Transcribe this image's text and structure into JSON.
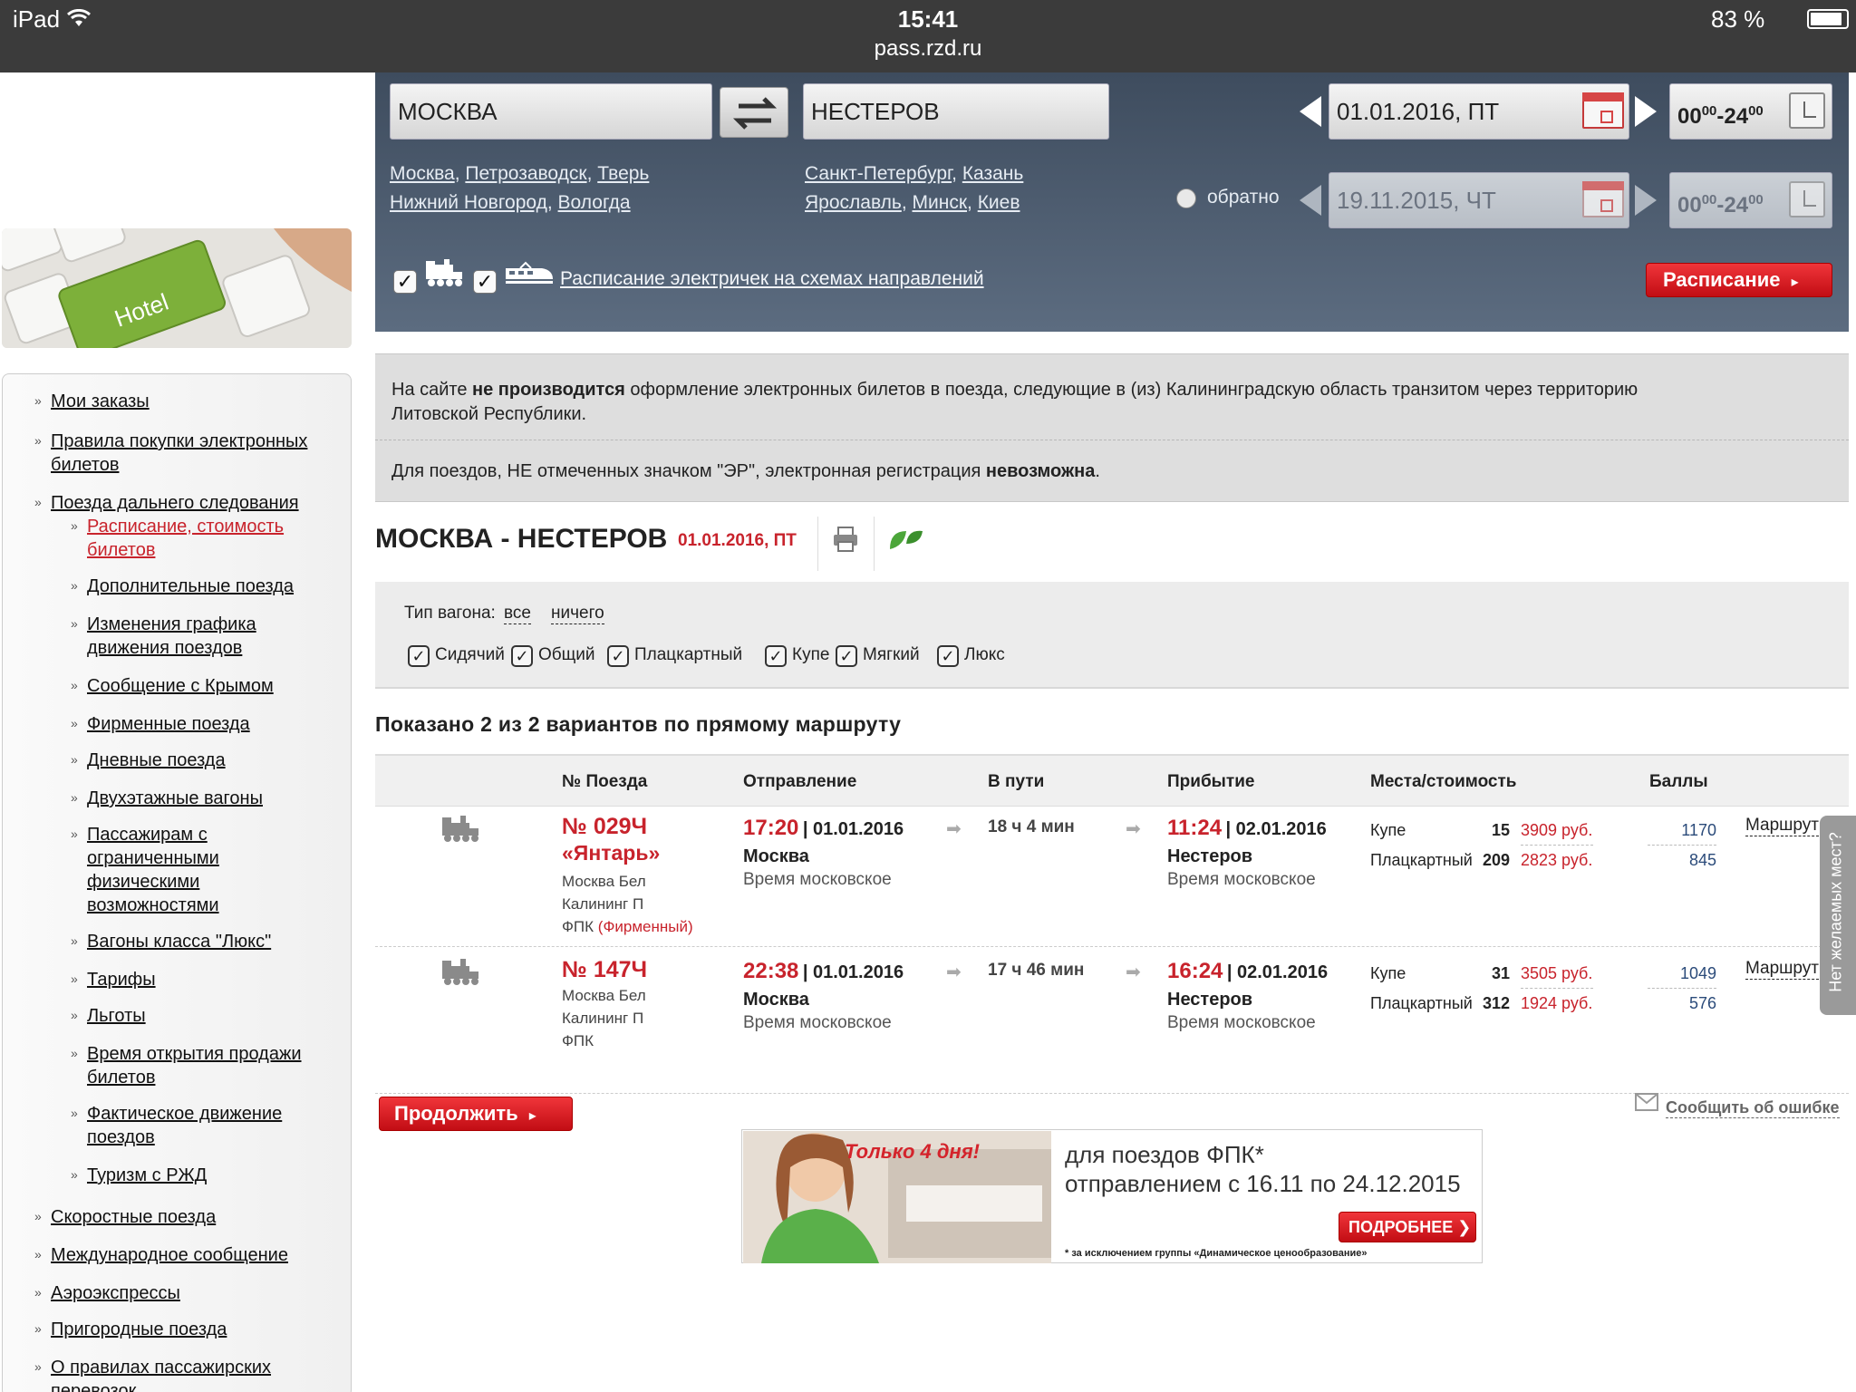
{
  "status_bar": {
    "device": "iPad",
    "time": "15:41",
    "url": "pass.rzd.ru",
    "battery": "83 %"
  },
  "search": {
    "from_value": "МОСКВА",
    "to_value": "НЕСТЕРОВ",
    "from_suggestions": [
      [
        "Москва",
        "Петрозаводск",
        "Тверь"
      ],
      [
        "Нижний Новгород",
        "Вологда"
      ]
    ],
    "to_suggestions": [
      [
        "Санкт-Петербург",
        "Казань"
      ],
      [
        "Ярославль",
        "Минск",
        "Киев"
      ]
    ],
    "date_there": "01.01.2016, ПТ",
    "date_back": "19.11.2015, ЧТ",
    "time_range_there": {
      "from": "00",
      "from_sup": "00",
      "to": "24",
      "to_sup": "00"
    },
    "time_range_back": {
      "from": "00",
      "from_sup": "00",
      "to": "24",
      "to_sup": "00"
    },
    "return_label": "обратно",
    "schedule_link": "Расписание электричек на схемах направлений",
    "schedule_button": "Расписание"
  },
  "sidebar": {
    "items": [
      {
        "label": "Мои заказы",
        "level": 0
      },
      {
        "label": "Правила покупки электронных билетов",
        "level": 0
      },
      {
        "label": "Поезда дальнего следования",
        "level": 0
      },
      {
        "label": "Расписание, стоимость билетов",
        "level": 1,
        "active": true
      },
      {
        "label": "Дополнительные поезда",
        "level": 1
      },
      {
        "label": "Изменения графика движения поездов",
        "level": 1
      },
      {
        "label": "Сообщение с Крымом",
        "level": 1
      },
      {
        "label": "Фирменные поезда",
        "level": 1
      },
      {
        "label": "Дневные поезда",
        "level": 1
      },
      {
        "label": "Двухэтажные вагоны",
        "level": 1
      },
      {
        "label": "Пассажирам с ограниченными физическими возможностями",
        "level": 1
      },
      {
        "label": "Вагоны класса \"Люкс\"",
        "level": 1
      },
      {
        "label": "Тарифы",
        "level": 1
      },
      {
        "label": "Льготы",
        "level": 1
      },
      {
        "label": "Время открытия продажи билетов",
        "level": 1
      },
      {
        "label": "Фактическое движение поездов",
        "level": 1
      },
      {
        "label": "Туризм с РЖД",
        "level": 1
      },
      {
        "label": "Скоростные поезда",
        "level": 0
      },
      {
        "label": "Международное сообщение",
        "level": 0
      },
      {
        "label": "Аэроэкспрессы",
        "level": 0
      },
      {
        "label": "Пригородные поезда",
        "level": 0
      },
      {
        "label": "О правилах пассажирских перевозок",
        "level": 0
      }
    ],
    "hotel_banner_text": "Hotel"
  },
  "notice": {
    "line1_pre": "На сайте ",
    "line1_bold": "не производится",
    "line1_post": " оформление электронных билетов в поезда, следующие в (из) Калининградскую область транзитом через территорию",
    "line1_cont": "Литовской Республики.",
    "line2_pre": "Для поездов, НЕ отмеченных значком \"ЭР\", электронная регистрация ",
    "line2_bold": "невозможна",
    "line2_post": "."
  },
  "route": {
    "title": "МОСКВА - НЕСТЕРОВ",
    "date": "01.01.2016, ПТ"
  },
  "filter": {
    "label": "Тип вагона:",
    "all": "все",
    "none": "ничего",
    "types": [
      "Сидячий",
      "Общий",
      "Плацкартный",
      "Купе",
      "Мягкий",
      "Люкс"
    ]
  },
  "results": {
    "summary": "Показано 2 из 2 вариантов по прямому маршруту",
    "headers": {
      "train": "№ Поезда",
      "departure": "Отправление",
      "duration": "В пути",
      "arrival": "Прибытие",
      "seats": "Места/стоимость",
      "points": "Баллы"
    },
    "rows": [
      {
        "number": "№ 029Ч",
        "name": "«Янтарь»",
        "from_station": "Москва Бел",
        "to_station": "Калининг П",
        "carrier": "ФПК",
        "carrier_note": "(Фирменный)",
        "dep_time": "17:20",
        "dep_date": "| 01.01.2016",
        "dep_city": "Москва",
        "dep_tz": "Время московское",
        "duration": "18 ч 4 мин",
        "arr_time": "11:24",
        "arr_date": "| 02.01.2016",
        "arr_city": "Нестеров",
        "arr_tz": "Время московское",
        "seats": [
          {
            "type": "Купе",
            "count": "15",
            "price": "3909 руб.",
            "points": "1170"
          },
          {
            "type": "Плацкартный",
            "count": "209",
            "price": "2823 руб.",
            "points": "845"
          }
        ],
        "route_link": "Маршрут"
      },
      {
        "number": "№ 147Ч",
        "name": "",
        "from_station": "Москва Бел",
        "to_station": "Калининг П",
        "carrier": "ФПК",
        "carrier_note": "",
        "dep_time": "22:38",
        "dep_date": "| 01.01.2016",
        "dep_city": "Москва",
        "dep_tz": "Время московское",
        "duration": "17 ч 46 мин",
        "arr_time": "16:24",
        "arr_date": "| 02.01.2016",
        "arr_city": "Нестеров",
        "arr_tz": "Время московское",
        "seats": [
          {
            "type": "Купе",
            "count": "31",
            "price": "3505 руб.",
            "points": "1049"
          },
          {
            "type": "Плацкартный",
            "count": "312",
            "price": "1924 руб.",
            "points": "576"
          }
        ],
        "route_link": "Маршрут"
      }
    ],
    "continue_button": "Продолжить",
    "report_error": "Сообщить об ошибке",
    "side_tab": "Нет желаемых мест?"
  },
  "promo": {
    "sticker": "Только 4 дня!",
    "line1": "для поездов ФПК*",
    "line2": "отправлением с 16.11 по 24.12.2015",
    "button": "ПОДРОБНЕЕ",
    "footnote": "* за исключением группы «Динамическое ценообразование»"
  },
  "colors": {
    "brand_red": "#c8232c",
    "header_bg": "#4b5a6d",
    "notice_bg": "#dedede"
  }
}
